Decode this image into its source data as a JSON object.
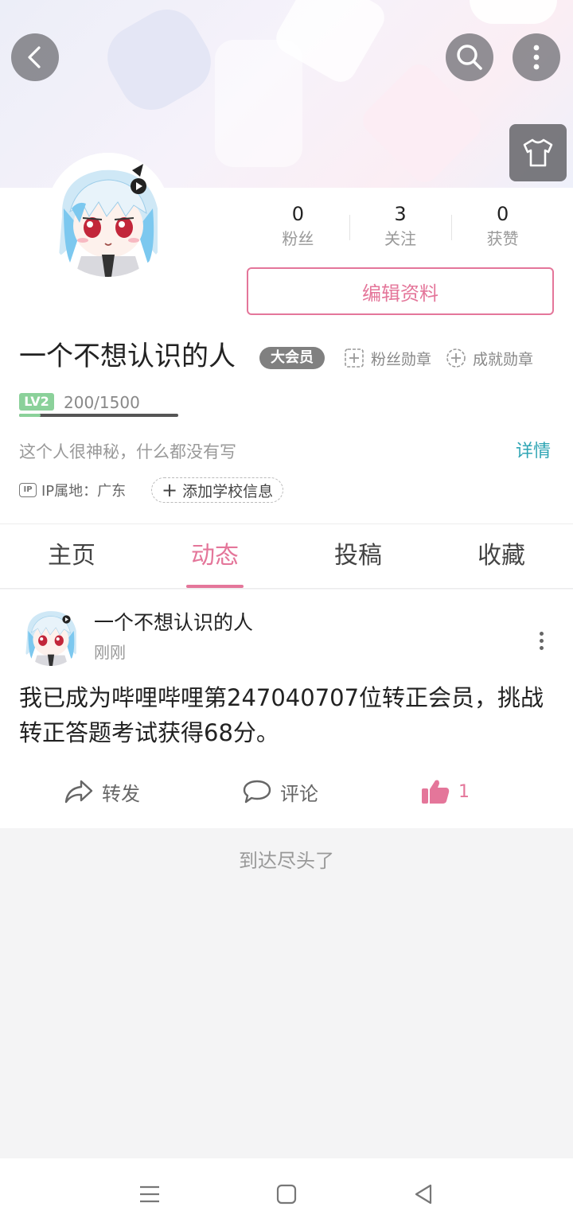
{
  "header": {
    "icons": [
      "back-icon",
      "search-icon",
      "more-icon",
      "shirt-icon"
    ]
  },
  "profile": {
    "stats": [
      {
        "num": "0",
        "label": "粉丝"
      },
      {
        "num": "3",
        "label": "关注"
      },
      {
        "num": "0",
        "label": "获赞"
      }
    ],
    "edit_label": "编辑资料",
    "name": "一个不想认识的人",
    "vip_label": "大会员",
    "fan_medal_label": "粉丝勋章",
    "achievement_medal_label": "成就勋章",
    "level_badge": "LV2",
    "level_progress": "200/1500",
    "level_fraction": 0.1333,
    "bio": "这个人很神秘，什么都没有写",
    "detail_label": "详情",
    "ip_badge": "IP",
    "ip_label": "IP属地：广东",
    "school_label": "添加学校信息"
  },
  "tabs": [
    {
      "label": "主页",
      "active": false
    },
    {
      "label": "动态",
      "active": true
    },
    {
      "label": "投稿",
      "active": false
    },
    {
      "label": "收藏",
      "active": false
    }
  ],
  "post": {
    "author": "一个不想认识的人",
    "time": "刚刚",
    "text": "我已成为哔哩哔哩第247040707位转正会员，挑战转正答题考试获得68分。",
    "share_label": "转发",
    "comment_label": "评论",
    "like_count": "1"
  },
  "feed_end": "到达尽头了",
  "colors": {
    "accent_pink": "#e4769a",
    "link_teal": "#2fa5b4",
    "level_green": "#8bd19a",
    "vip_gray": "#808080"
  }
}
